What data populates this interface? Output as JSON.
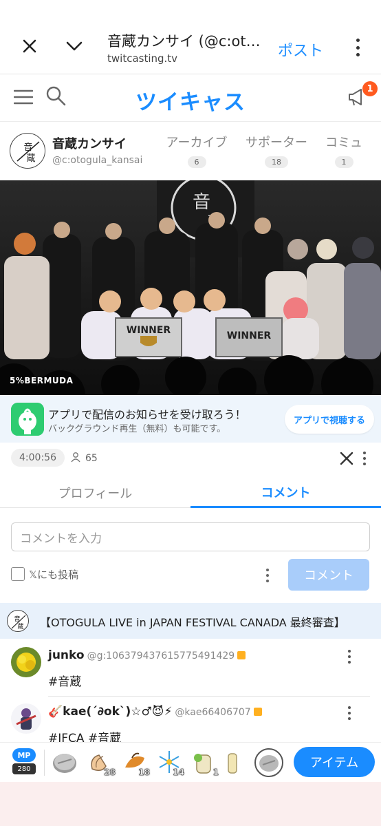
{
  "browser": {
    "title": "音蔵カンサイ (@c:oto…",
    "url": "twitcasting.tv",
    "post_label": "ポスト"
  },
  "site": {
    "logo_text": "ツイキャス",
    "notification_count": "1",
    "brand_color": "#1a8cff"
  },
  "channel": {
    "name": "音蔵カンサイ",
    "user_id": "@c:otogula_kansai",
    "tabs": [
      {
        "label": "アーカイブ",
        "count": "6"
      },
      {
        "label": "サポーター",
        "count": "18"
      },
      {
        "label": "コミュ",
        "count": "1"
      }
    ]
  },
  "video": {
    "banner_text_1": "WINNER",
    "banner_text_2": "WINNER",
    "corner_label": "5%BERMUDA"
  },
  "promo": {
    "title": "アプリで配信のお知らせを受け取ろう！",
    "subtitle": "バックグラウンド再生（無料）も可能です。",
    "button_label": "アプリで視聴する"
  },
  "stats": {
    "elapsed_time": "4:00:56",
    "viewer_count": "65"
  },
  "tabs": {
    "profile": "プロフィール",
    "comment": "コメント"
  },
  "comment_form": {
    "placeholder": "コメントを入力",
    "x_post_label": "𝕏にも投稿",
    "submit_label": "コメント"
  },
  "live_title": "【OTOGULA LIVE in JAPAN FESTIVAL CANADA 最終審査】",
  "comments": [
    {
      "name": "junko",
      "user_id": "@g:106379437615775491429",
      "text": "#音蔵"
    },
    {
      "name": "🎸kae(´∂ok`)☆♂😈⚡",
      "user_id": "@kae66406707",
      "text": "#JFCA #音蔵"
    }
  ],
  "itembar": {
    "mp_label": "MP",
    "mp_value": "280",
    "items": [
      {
        "icon": "coin-icon",
        "count": ""
      },
      {
        "icon": "clap-icon",
        "count": "28"
      },
      {
        "icon": "bird-icon",
        "count": "18"
      },
      {
        "icon": "firework-icon",
        "count": "14"
      },
      {
        "icon": "tea-icon",
        "count": "1"
      },
      {
        "icon": "drink-icon",
        "count": ""
      },
      {
        "icon": "coin-silver-icon",
        "count": ""
      }
    ],
    "button_label": "アイテム"
  }
}
